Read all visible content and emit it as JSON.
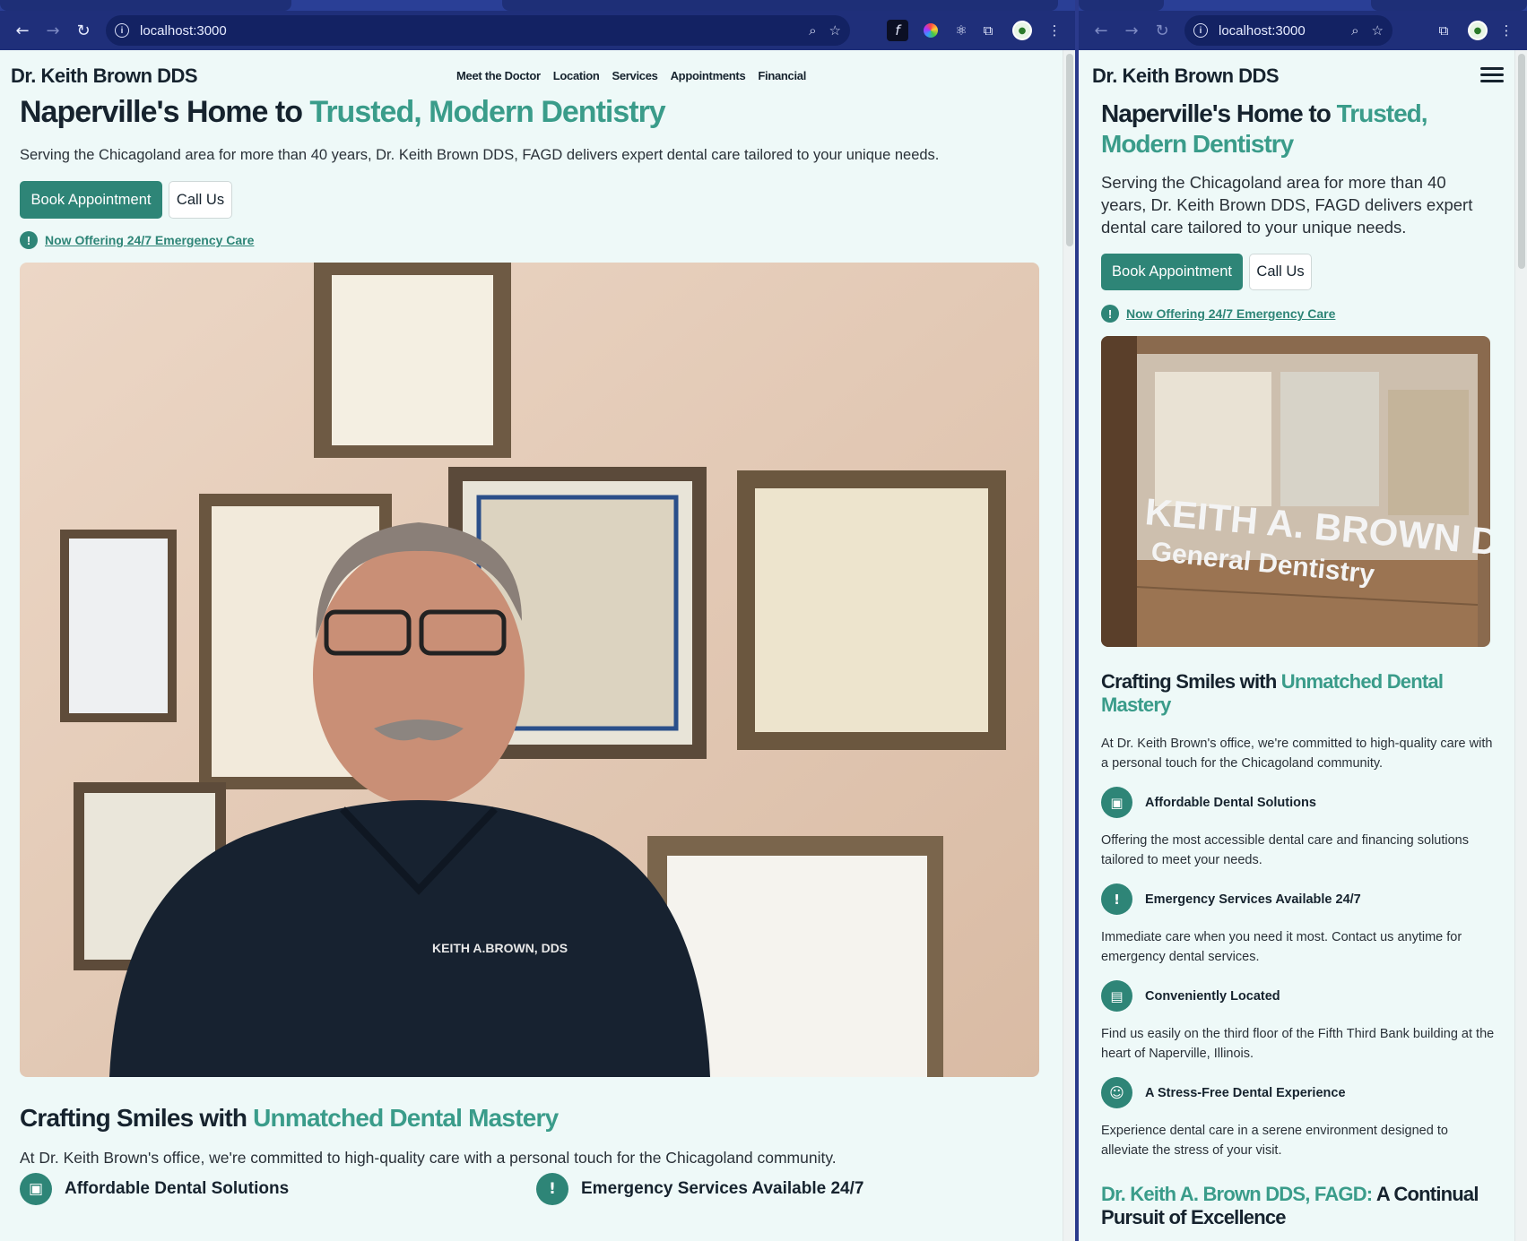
{
  "browser": {
    "url": "localhost:3000"
  },
  "site": {
    "brand": "Dr. Keith Brown DDS",
    "nav": [
      "Meet the Doctor",
      "Location",
      "Services",
      "Appointments",
      "Financial"
    ],
    "hero": {
      "title_plain": "Naperville's Home to ",
      "title_accent": "Trusted, Modern Dentistry",
      "subtitle": "Serving the Chicagoland area for more than 40 years, Dr. Keith Brown DDS, FAGD delivers expert dental care tailored to your unique needs.",
      "book_label": "Book Appointment",
      "call_label": "Call Us",
      "emergency_link": "Now Offering 24/7 Emergency Care"
    },
    "photo_left_text": "KEITH A.BROWN, DDS",
    "photo_right_text_line1": "KEITH A. BROWN D.D.S.",
    "photo_right_text_line2": "General Dentistry",
    "crafting": {
      "title_plain": "Crafting Smiles with ",
      "title_accent": "Unmatched Dental Mastery",
      "body": "At Dr. Keith Brown's office, we're committed to high-quality care with a personal touch for the Chicagoland community."
    },
    "features": [
      {
        "icon": "cash-icon",
        "title": "Affordable Dental Solutions",
        "desc": "Offering the most accessible dental care and financing solutions tailored to meet your needs."
      },
      {
        "icon": "alert-icon",
        "title": "Emergency Services Available 24/7",
        "desc": "Immediate care when you need it most. Contact us anytime for emergency dental services."
      },
      {
        "icon": "map-icon",
        "title": "Conveniently Located",
        "desc": "Find us easily on the third floor of the Fifth Third Bank building at the heart of Naperville, Illinois."
      },
      {
        "icon": "smile-icon",
        "title": "A Stress-Free Dental Experience",
        "desc": "Experience dental care in a serene environment designed to alleviate the stress of your visit."
      }
    ],
    "excellence": {
      "title_accent": "Dr. Keith A. Brown DDS, FAGD:",
      "title_plain": " A Continual Pursuit of Excellence"
    }
  },
  "colors": {
    "accent": "#3a9c8a",
    "primary_button": "#2e8577",
    "page_bg": "#eef9f8",
    "chrome_toolbar": "#1f2f7a"
  }
}
